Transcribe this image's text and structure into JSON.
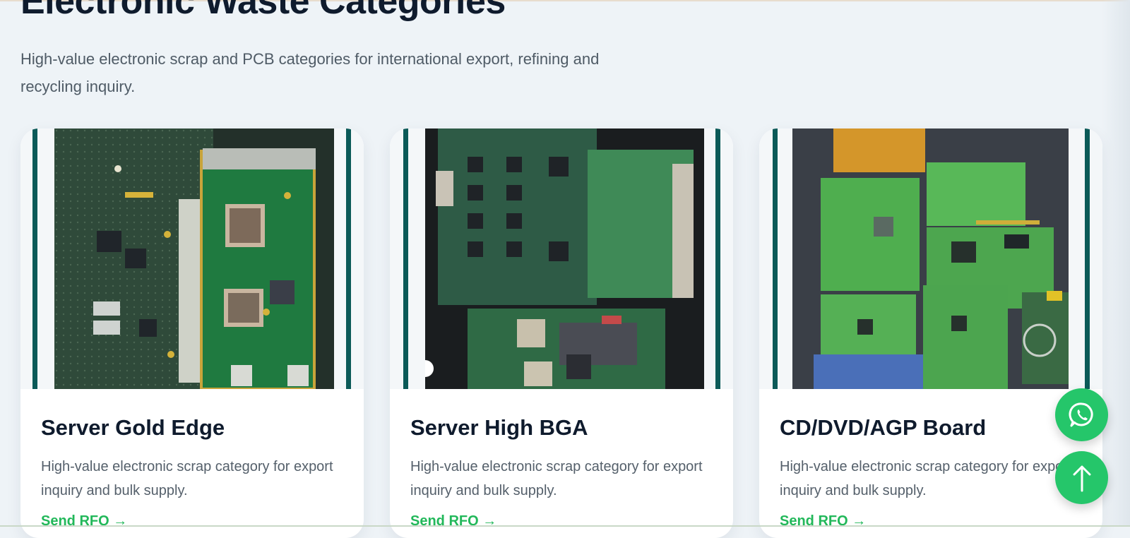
{
  "section": {
    "title": "Electronic Waste Categories",
    "subtitle": "High-value electronic scrap and PCB categories for international export, refining and recycling inquiry."
  },
  "cards": [
    {
      "title": "Server Gold Edge",
      "description": "High-value electronic scrap category for export inquiry and bulk supply.",
      "link_label": "Send RFQ →",
      "image_icon": "pcb-photo"
    },
    {
      "title": "Server High BGA",
      "description": "High-value electronic scrap category for export inquiry and bulk supply.",
      "link_label": "Send RFQ →",
      "image_icon": "pcb-photo"
    },
    {
      "title": "CD/DVD/AGP Board",
      "description": "High-value electronic scrap category for export inquiry and bulk supply.",
      "link_label": "Send RFQ →",
      "image_icon": "pcb-photo"
    }
  ],
  "floating": {
    "whatsapp_icon": "whatsapp-icon",
    "top_icon": "arrow-up-icon"
  },
  "colors": {
    "accent": "#25c66a",
    "link": "#22b85a",
    "frame": "#0b5a58",
    "heading": "#0f1b2d",
    "body_text": "#55606b",
    "page_bg": "#eef3f7"
  }
}
